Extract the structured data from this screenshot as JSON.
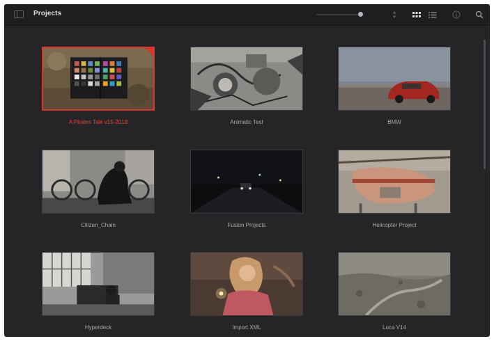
{
  "window": {
    "title": "Projects"
  },
  "toolbar": {
    "icons": [
      "sidebar-toggle-icon",
      "sort-icon",
      "grid-view-icon",
      "list-view-icon",
      "info-icon",
      "search-icon"
    ],
    "zoom_level": 0.9,
    "active_view": "grid"
  },
  "colors": {
    "background": "#252528",
    "topbar": "#1e1e21",
    "selected_accent": "#e8453a",
    "label": "#a9a9ae"
  },
  "projects": [
    {
      "name": "A Pirates Tale v15-2018",
      "selected": true
    },
    {
      "name": "Animatic Test",
      "selected": false
    },
    {
      "name": "BMW",
      "selected": false
    },
    {
      "name": "Citizen_Chain",
      "selected": false
    },
    {
      "name": "Fusion Projects",
      "selected": false
    },
    {
      "name": "Helicopter Project",
      "selected": false
    },
    {
      "name": "Hyperdeck",
      "selected": false
    },
    {
      "name": "Import XML",
      "selected": false
    },
    {
      "name": "Luca V14",
      "selected": false
    }
  ]
}
